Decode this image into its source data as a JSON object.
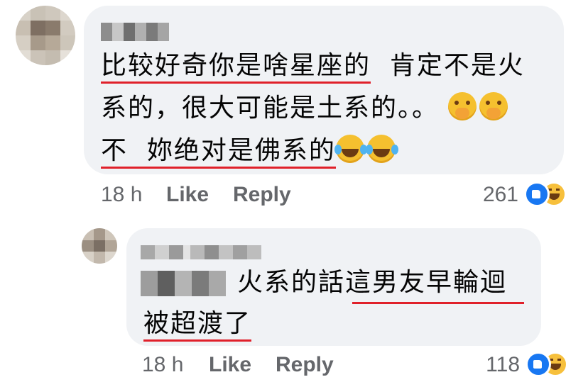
{
  "comment1": {
    "line1a": "比较好奇你是啥星座的",
    "line1b": "肯定不是火",
    "line2": "系的，很大可能是土系的。。",
    "line3a": "不",
    "line3b": "妳绝对是佛系的",
    "emoji_line2": [
      "hushed-face",
      "hushed-face"
    ],
    "emoji_line3": [
      "tears-of-joy",
      "tears-of-joy"
    ],
    "time": "18 h",
    "like_label": "Like",
    "reply_label": "Reply",
    "reaction_count": "261",
    "reactions": [
      "like",
      "haha"
    ]
  },
  "comment2": {
    "line1": "火系的話這男友早輪迴",
    "line2": "被超渡了",
    "time": "18 h",
    "like_label": "Like",
    "reply_label": "Reply",
    "reaction_count": "118",
    "reactions": [
      "like",
      "haha"
    ]
  },
  "colors": {
    "bubble": "#f0f2f5",
    "meta_text": "#65676b",
    "underline": "#e0202a",
    "like_blue": "#1877f2",
    "haha_yellow": "#f7c03c"
  }
}
